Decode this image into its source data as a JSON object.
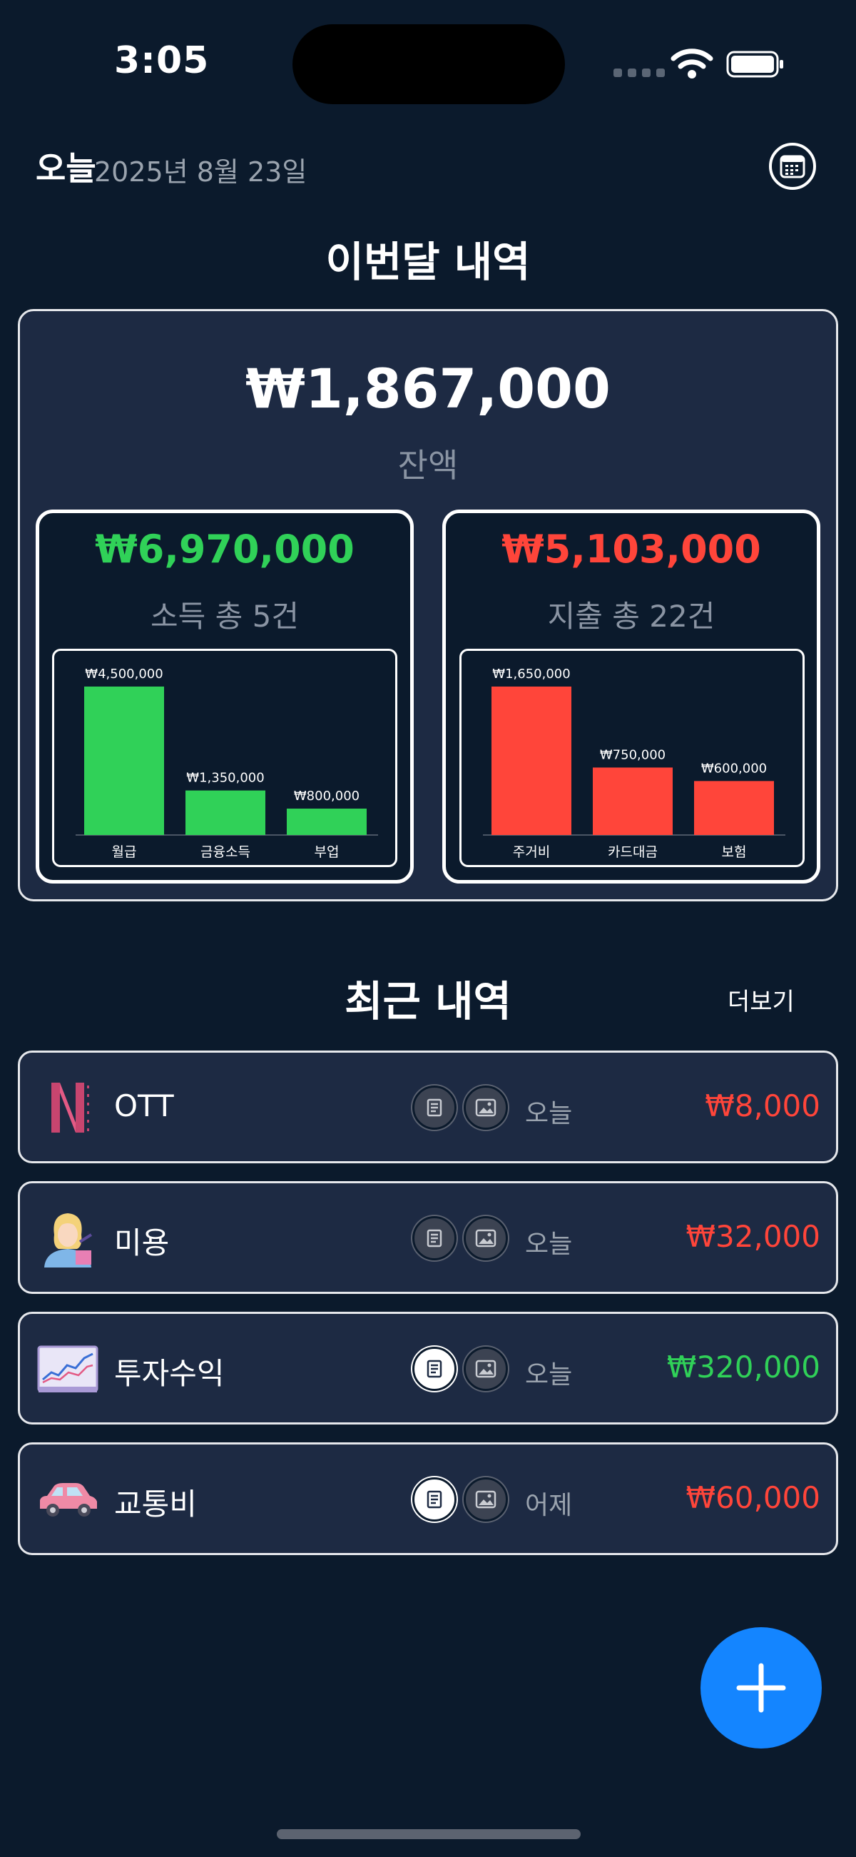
{
  "status_bar": {
    "time": "3:05"
  },
  "header": {
    "today_label": "오늘",
    "date": "2025년 8월 23일",
    "calendar_icon": "calendar-icon"
  },
  "monthly": {
    "title": "이번달 내역",
    "balance": "₩1,867,000",
    "balance_label": "잔액",
    "income": {
      "total": "₩6,970,000",
      "label": "소득 총 5건",
      "color": "#30d158"
    },
    "expense": {
      "total": "₩5,103,000",
      "label": "지출 총 22건",
      "color": "#ff453a"
    }
  },
  "chart_data": [
    {
      "type": "bar",
      "categories": [
        "월급",
        "금융소득",
        "부업"
      ],
      "values": [
        4500000,
        1350000,
        800000
      ],
      "data_labels": [
        "₩4,500,000",
        "₩1,350,000",
        "₩800,000"
      ],
      "color": "#30d158",
      "title": "",
      "xlabel": "",
      "ylabel": "",
      "ylim": [
        0,
        4500000
      ],
      "grid": false
    },
    {
      "type": "bar",
      "categories": [
        "주거비",
        "카드대금",
        "보험"
      ],
      "values": [
        1650000,
        750000,
        600000
      ],
      "data_labels": [
        "₩1,650,000",
        "₩750,000",
        "₩600,000"
      ],
      "color": "#ff453a",
      "title": "",
      "xlabel": "",
      "ylabel": "",
      "ylim": [
        0,
        1650000
      ],
      "grid": false
    }
  ],
  "recent": {
    "title": "최근 내역",
    "more": "더보기",
    "items": [
      {
        "icon": "netflix-icon",
        "name": "OTT",
        "date": "오늘",
        "amount": "₩8,000",
        "type": "expense",
        "memo_active": false,
        "photo_active": false
      },
      {
        "icon": "beauty-icon",
        "name": "미용",
        "date": "오늘",
        "amount": "₩32,000",
        "type": "expense",
        "memo_active": false,
        "photo_active": false
      },
      {
        "icon": "stock-chart-icon",
        "name": "투자수익",
        "date": "오늘",
        "amount": "₩320,000",
        "type": "income",
        "memo_active": true,
        "photo_active": false
      },
      {
        "icon": "car-icon",
        "name": "교통비",
        "date": "어제",
        "amount": "₩60,000",
        "type": "expense",
        "memo_active": true,
        "photo_active": false
      }
    ]
  },
  "fab": {
    "icon": "plus-icon"
  }
}
